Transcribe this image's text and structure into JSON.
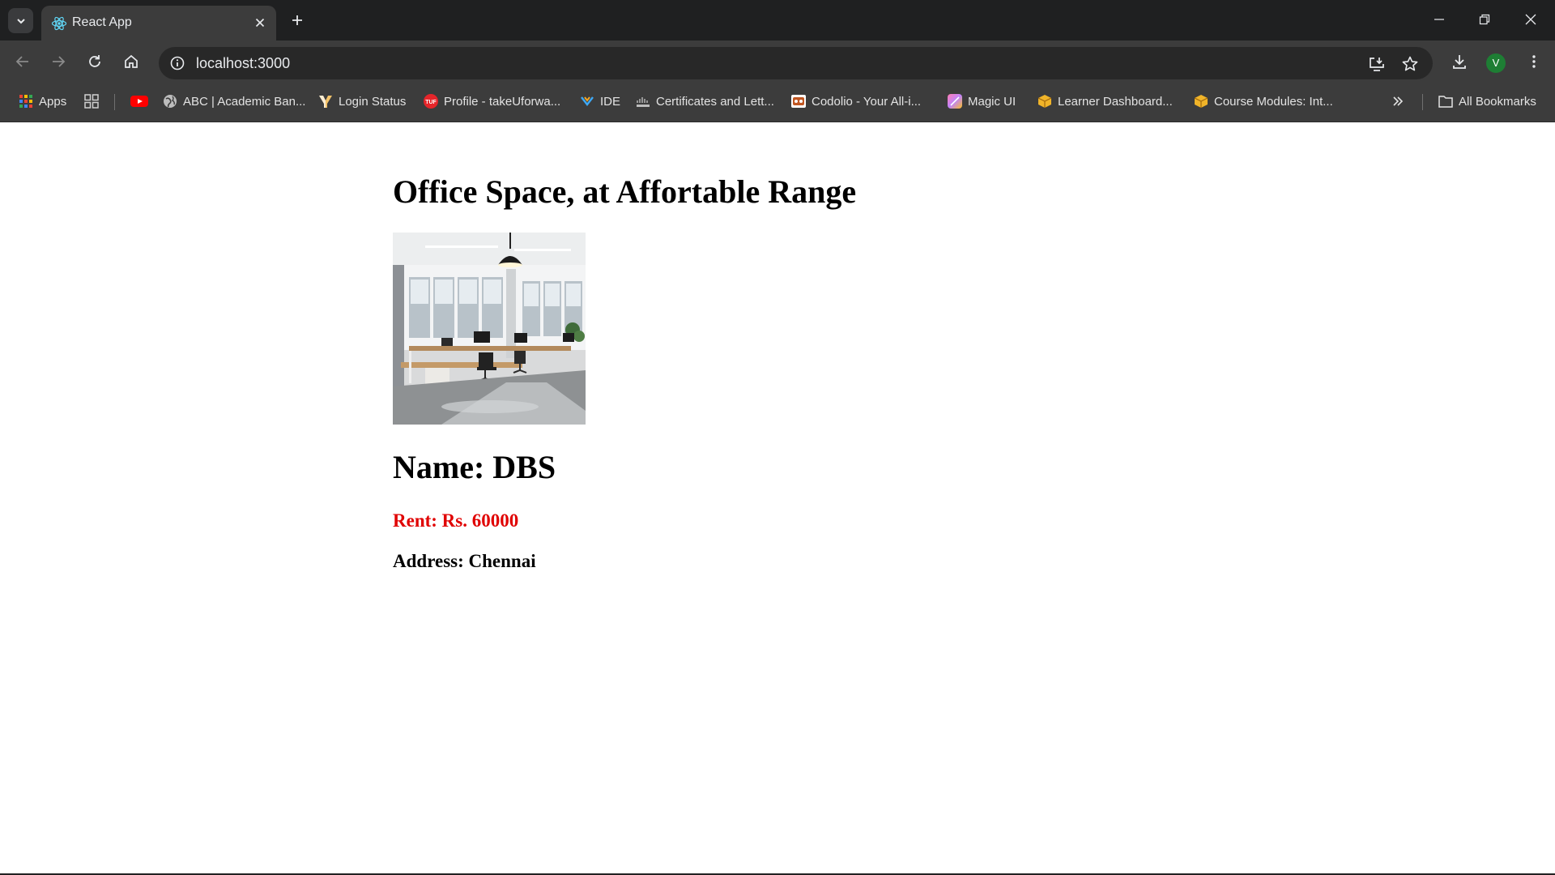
{
  "browser": {
    "tab": {
      "title": "React App",
      "favicon": "react-logo-icon"
    },
    "address_bar": {
      "url": "localhost:3000"
    },
    "profile_initial": "V",
    "bookmarks": [
      {
        "label": "Apps",
        "icon": "apps-grid-icon"
      },
      {
        "label": "",
        "icon": "tab-groups-icon"
      },
      {
        "label": "",
        "icon": "youtube-icon"
      },
      {
        "label": "ABC | Academic Ban...",
        "icon": "globe-icon"
      },
      {
        "label": "Login Status",
        "icon": "login-status-icon"
      },
      {
        "label": "Profile - takeUforwa...",
        "icon": "tuf-icon"
      },
      {
        "label": "IDE",
        "icon": "ide-icon"
      },
      {
        "label": "Certificates and Lett...",
        "icon": "cisco-icon"
      },
      {
        "label": "Codolio - Your All-i...",
        "icon": "codolio-icon"
      },
      {
        "label": "Magic UI",
        "icon": "magic-ui-icon"
      },
      {
        "label": "Learner Dashboard...",
        "icon": "package-icon"
      },
      {
        "label": "Course Modules: Int...",
        "icon": "package-icon"
      }
    ],
    "all_bookmarks_label": "All Bookmarks"
  },
  "page": {
    "title": "Office Space, at Affortable Range",
    "image_alt": "office-interior",
    "name_text": "Name: DBS",
    "rent_text": "Rent: Rs. 60000",
    "address_text": "Address: Chennai"
  },
  "colors": {
    "rent": "#e00000",
    "tab_active": "#3c3c3c",
    "tabstrip": "#1f2021",
    "avatar": "#1e7e34"
  }
}
